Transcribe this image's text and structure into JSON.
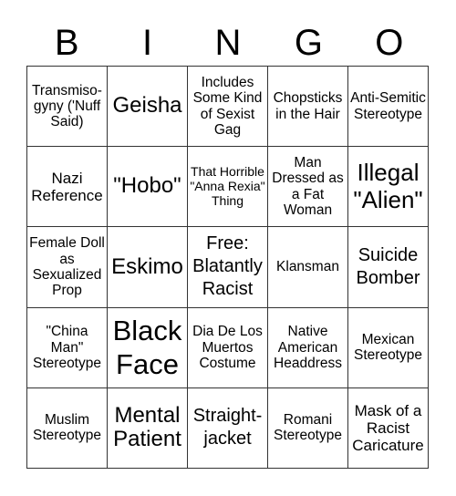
{
  "header": {
    "letters": [
      "B",
      "I",
      "N",
      "G",
      "O"
    ]
  },
  "grid": {
    "cells": [
      [
        "Transmiso-gyny ('Nuff Said)",
        "Geisha",
        "Includes Some Kind of Sexist Gag",
        "Chopsticks in the Hair",
        "Anti-Semitic Stereotype"
      ],
      [
        "Nazi Reference",
        "\"Hobo\"",
        "That Horrible \"Anna Rexia\" Thing",
        "Man Dressed as a Fat Woman",
        "Illegal \"Alien\""
      ],
      [
        "Female Doll as Sexualized Prop",
        "Eskimo",
        "Free: Blatantly Racist",
        "Klansman",
        "Suicide Bomber"
      ],
      [
        "\"China Man\" Stereotype",
        "Black Face",
        "Dia De Los Muertos Costume",
        "Native American Headdress",
        "Mexican Stereotype"
      ],
      [
        "Muslim Stereotype",
        "Mental Patient",
        "Straight-jacket",
        "Romani Stereotype",
        "Mask of a Racist Caricature"
      ]
    ]
  }
}
